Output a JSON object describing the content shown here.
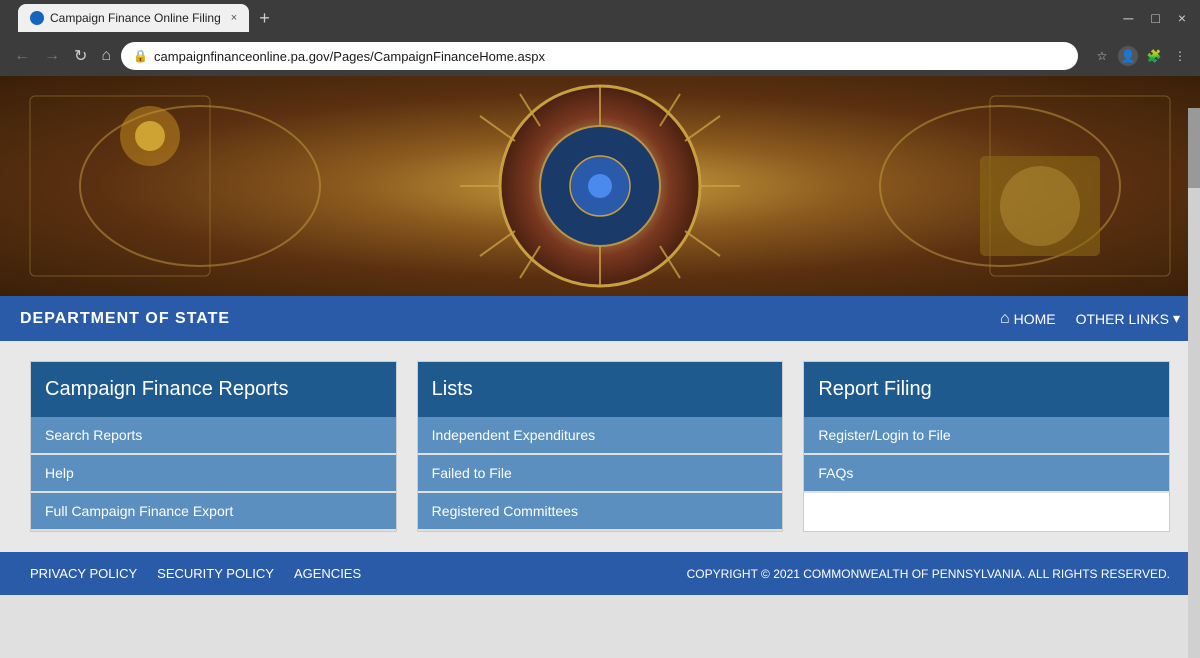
{
  "browser": {
    "tab_title": "Campaign Finance Online Filing",
    "url": "campaignfinanceonline.pa.gov/Pages/CampaignFinanceHome.aspx",
    "new_tab_label": "+",
    "close_tab": "×",
    "minimize": "─",
    "maximize": "□",
    "close_window": "×"
  },
  "nav": {
    "dept_title": "DEPARTMENT OF STATE",
    "home_label": "HOME",
    "other_links_label": "OTHER LINKS"
  },
  "cards": [
    {
      "id": "campaign-finance-reports",
      "header": "Campaign Finance Reports",
      "items": [
        {
          "label": "Search Reports",
          "id": "search-reports"
        },
        {
          "label": "Help",
          "id": "help"
        },
        {
          "label": "Full Campaign Finance Export",
          "id": "full-export"
        }
      ]
    },
    {
      "id": "lists",
      "header": "Lists",
      "items": [
        {
          "label": "Independent Expenditures",
          "id": "independent-expenditures"
        },
        {
          "label": "Failed to File",
          "id": "failed-to-file"
        },
        {
          "label": "Registered Committees",
          "id": "registered-committees"
        }
      ]
    },
    {
      "id": "report-filing",
      "header": "Report Filing",
      "items": [
        {
          "label": "Register/Login to File",
          "id": "register-login"
        },
        {
          "label": "FAQs",
          "id": "faqs"
        }
      ]
    }
  ],
  "footer": {
    "links": [
      {
        "label": "PRIVACY POLICY",
        "id": "privacy-policy"
      },
      {
        "label": "SECURITY POLICY",
        "id": "security-policy"
      },
      {
        "label": "AGENCIES",
        "id": "agencies"
      }
    ],
    "copyright": "COPYRIGHT © 2021 COMMONWEALTH OF PENNSYLVANIA. ALL RIGHTS RESERVED."
  }
}
